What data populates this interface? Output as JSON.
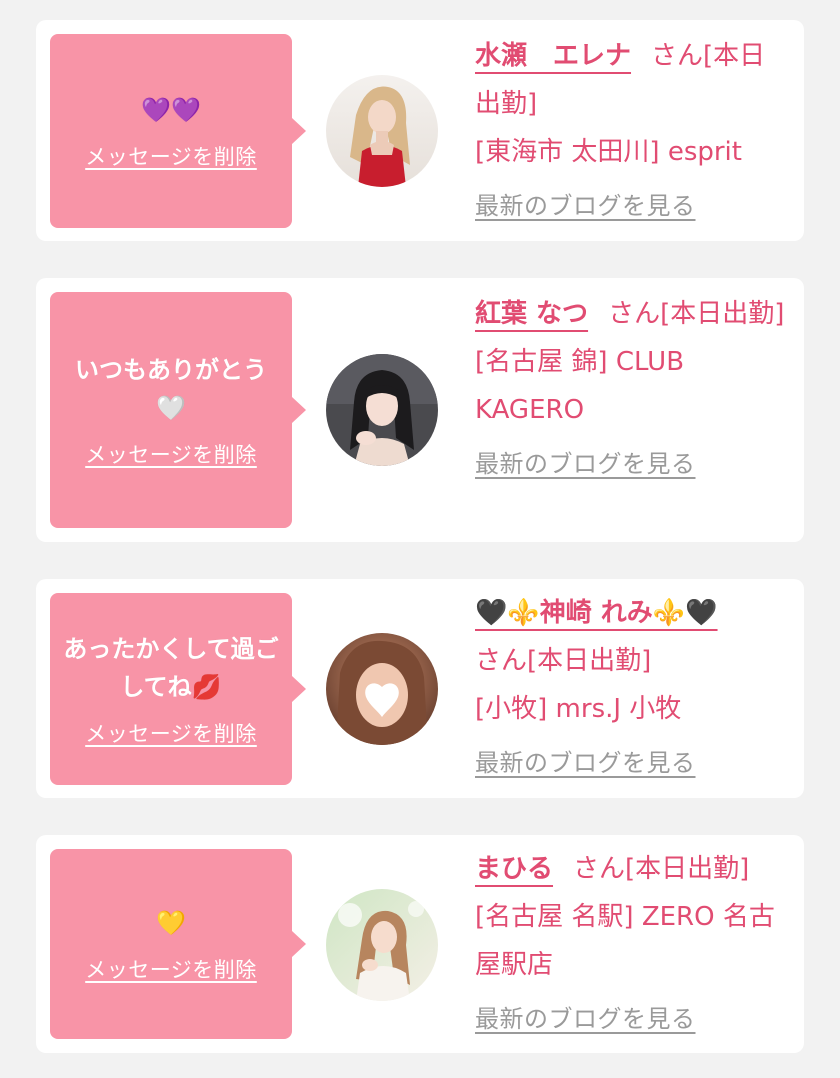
{
  "delete_label": "メッセージを削除",
  "blog_label": "最新のブログを見る",
  "cards": [
    {
      "message": "💜💜",
      "name": "水瀬　エレナ",
      "suffix": "さん[本日出勤]",
      "shop": "[東海市 太田川] esprit"
    },
    {
      "message": "いつもありがとう🤍",
      "name": "紅葉 なつ",
      "suffix": "さん[本日出勤]",
      "shop": "[名古屋 錦] CLUB KAGERO"
    },
    {
      "message": "あったかくして過ごしてね💋",
      "name": "🖤⚜️神崎 れみ⚜️🖤",
      "suffix": "さん[本日出勤]",
      "shop": "[小牧] mrs.J 小牧"
    },
    {
      "message": "💛",
      "name": "まひる",
      "suffix": "さん[本日出勤]",
      "shop": "[名古屋 名駅] ZERO 名古屋駅店"
    }
  ],
  "colors": {
    "bubble": "#f894a7",
    "accent": "#e14c72",
    "muted": "#9a9a9a",
    "background": "#f2f2f2"
  }
}
